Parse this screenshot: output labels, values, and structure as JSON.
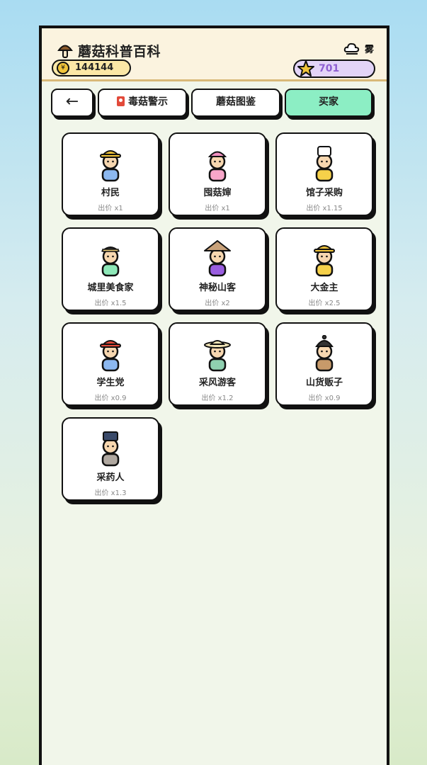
{
  "header": {
    "title": "蘑菇科普百科",
    "coins": "144144",
    "coin_symbol": "¥",
    "weather": "雾",
    "stars": "701"
  },
  "tabs": {
    "back": "←",
    "poison_warning": "毒菇警示",
    "mushroom_guide": "蘑菇图鉴",
    "buyers": "买家",
    "active": "buyers"
  },
  "buyers": [
    {
      "name": "村民",
      "price": "出价 x1",
      "shirt": "#8cb8f0",
      "hat": "#f0c43a",
      "hat_style": "cap"
    },
    {
      "name": "囤菇婶",
      "price": "出价 x1",
      "shirt": "#f7a6c9",
      "hat": "#f08fbf",
      "hat_style": "bandana"
    },
    {
      "name": "馆子采购",
      "price": "出价 x1.15",
      "shirt": "#f6d14a",
      "hat": "#ffffff",
      "hat_style": "chef"
    },
    {
      "name": "城里美食家",
      "price": "出价 x1.5",
      "shirt": "#8ee8b8",
      "hat": "#f0d07a",
      "hat_style": "band"
    },
    {
      "name": "神秘山客",
      "price": "出价 x2",
      "shirt": "#9a5ee0",
      "hat": "#c9a27a",
      "hat_style": "cone"
    },
    {
      "name": "大金主",
      "price": "出价 x2.5",
      "shirt": "#f6d14a",
      "hat": "#f0c43a",
      "hat_style": "cap"
    },
    {
      "name": "学生党",
      "price": "出价 x0.9",
      "shirt": "#8cb8f0",
      "hat": "#e24a3a",
      "hat_style": "cap"
    },
    {
      "name": "采风游客",
      "price": "出价 x1.2",
      "shirt": "#8fd0b0",
      "hat": "#f3e6b8",
      "hat_style": "wide"
    },
    {
      "name": "山货贩子",
      "price": "出价 x0.9",
      "shirt": "#c79a6a",
      "hat": "#333333",
      "hat_style": "beanie"
    },
    {
      "name": "采药人",
      "price": "出价 x1.3",
      "shirt": "#b0a8a0",
      "hat": "#3a4a6a",
      "hat_style": "box"
    }
  ],
  "colors": {
    "accent_tab": "#8ceec4",
    "coin_pill": "#fbe7a6",
    "star_pill": "#e3d4f7",
    "star_text": "#8e5fd1",
    "skin": "#f7d7b0"
  }
}
